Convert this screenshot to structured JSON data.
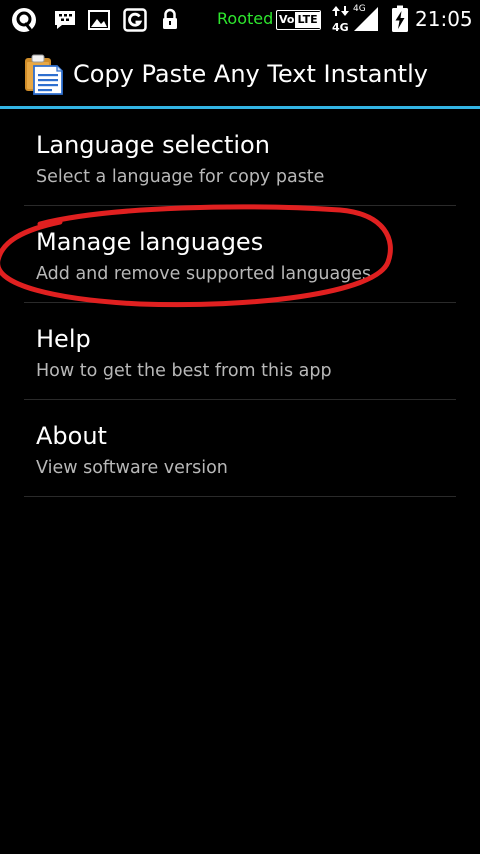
{
  "status_bar": {
    "rooted_label": "Rooted",
    "volte_vo": "Vo",
    "volte_lte": "LTE",
    "network_small": "4G",
    "network_large": "4G",
    "time": "21:05",
    "icons": [
      "notification-o-icon",
      "bbm-icon",
      "image-icon",
      "g-app-icon",
      "lock-icon",
      "data-arrows-icon",
      "signal-icon",
      "battery-charging-icon"
    ],
    "rooted_color": "#2ee62e"
  },
  "action_bar": {
    "title": "Copy Paste Any Text Instantly",
    "divider_color": "#33b5e5"
  },
  "preferences": [
    {
      "title": "Language selection",
      "summary": "Select a language for copy paste"
    },
    {
      "title": "Manage languages",
      "summary": "Add and remove supported languages"
    },
    {
      "title": "Help",
      "summary": "How to get the best from this app"
    },
    {
      "title": "About",
      "summary": "View software version"
    }
  ],
  "annotation": {
    "highlight_color": "#e02020",
    "highlighted_item": "Manage languages"
  }
}
